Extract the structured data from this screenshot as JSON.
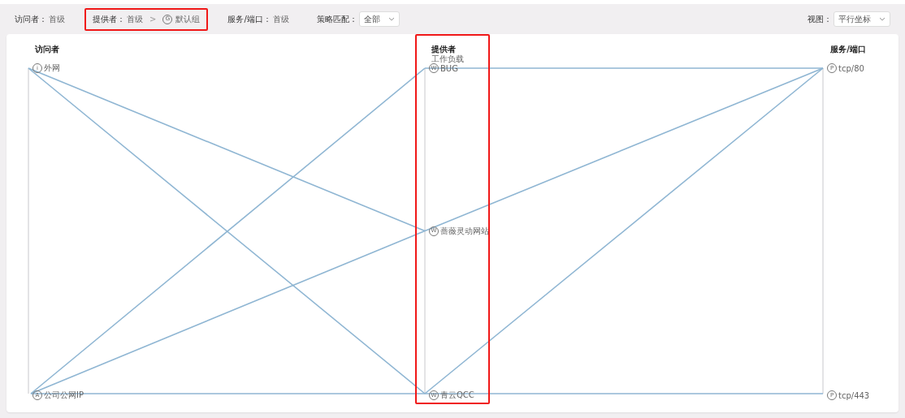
{
  "filters": [
    {
      "kind": "level",
      "label": "访问者：",
      "value": "首级",
      "highlighted": false
    },
    {
      "kind": "breadcrumb",
      "label": "提供者：",
      "value": "首级",
      "separator": ">",
      "icon": "G",
      "current": "默认组",
      "highlighted": true
    },
    {
      "kind": "level",
      "label": "服务/端口：",
      "value": "首级",
      "highlighted": false
    },
    {
      "kind": "select",
      "label": "策略匹配：",
      "value": "全部",
      "highlighted": false
    }
  ],
  "view": {
    "label": "视图：",
    "value": "平行坐标"
  },
  "axes": [
    {
      "title": "访问者",
      "highlighted": false,
      "nodes": [
        {
          "icon": "i",
          "label": "外网"
        },
        {
          "icon": "A",
          "label": "公司公网IP"
        }
      ]
    },
    {
      "title": "提供者",
      "subtitle": "工作负载",
      "highlighted": true,
      "nodes": [
        {
          "icon": "W",
          "label": "BUG",
          "linked_visitors": [
            false,
            true
          ],
          "linked_services": [
            true,
            false
          ]
        },
        {
          "icon": "W",
          "label": "蔷薇灵动网站",
          "linked_visitors": [
            true,
            true
          ],
          "linked_services": [
            true,
            false
          ]
        },
        {
          "icon": "W",
          "label": "青云QCC",
          "linked_visitors": [
            true,
            true
          ],
          "linked_services": [
            true,
            true
          ]
        }
      ]
    },
    {
      "title": "服务/端口",
      "highlighted": false,
      "nodes": [
        {
          "icon": "P",
          "label": "tcp/80"
        },
        {
          "icon": "P",
          "label": "tcp/443"
        }
      ]
    }
  ]
}
